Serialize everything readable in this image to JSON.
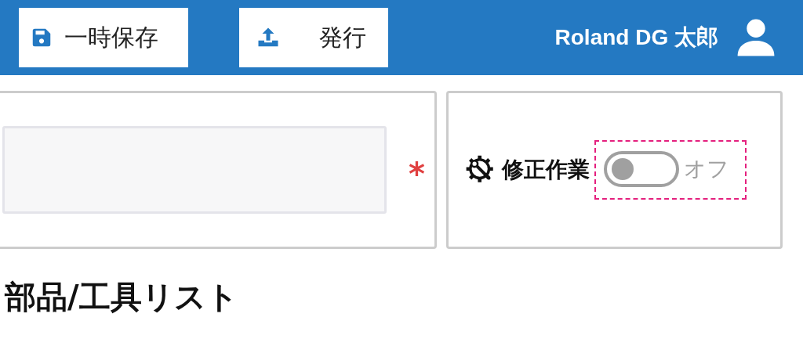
{
  "toolbar": {
    "buttons": [
      {
        "kind": "save",
        "label": "一時保存"
      },
      {
        "kind": "publish",
        "label": "発行"
      }
    ],
    "user_name": "Roland DG 太郎"
  },
  "form": {
    "field": {
      "required_mark": "*"
    },
    "toggle": {
      "label": "修正作業",
      "on": false,
      "focused": true,
      "state_text": "オフ"
    }
  },
  "section_title": "部品/工具リスト"
}
